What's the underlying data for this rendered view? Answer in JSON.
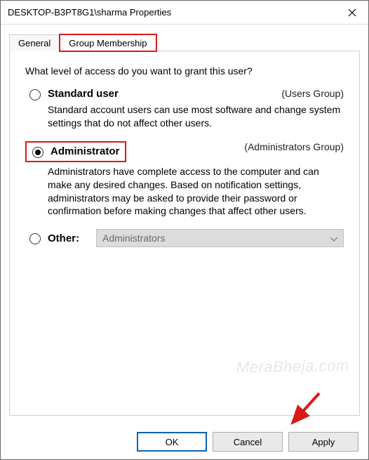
{
  "window": {
    "title": "DESKTOP-B3PT8G1\\sharma Properties"
  },
  "tabs": {
    "general": "General",
    "group_membership": "Group Membership"
  },
  "content": {
    "question": "What level of access do you want to grant this user?",
    "standard": {
      "label": "Standard user",
      "group": "(Users Group)",
      "desc": "Standard account users can use most software and change system settings that do not affect other users."
    },
    "admin": {
      "label": "Administrator",
      "group": "(Administrators Group)",
      "desc": "Administrators have complete access to the computer and can make any desired changes. Based on notification settings, administrators may be asked to provide their password or confirmation before making changes that affect other users."
    },
    "other": {
      "label": "Other:",
      "combo_value": "Administrators"
    }
  },
  "buttons": {
    "ok": "OK",
    "cancel": "Cancel",
    "apply": "Apply"
  },
  "watermark": "MeraBheja.com"
}
